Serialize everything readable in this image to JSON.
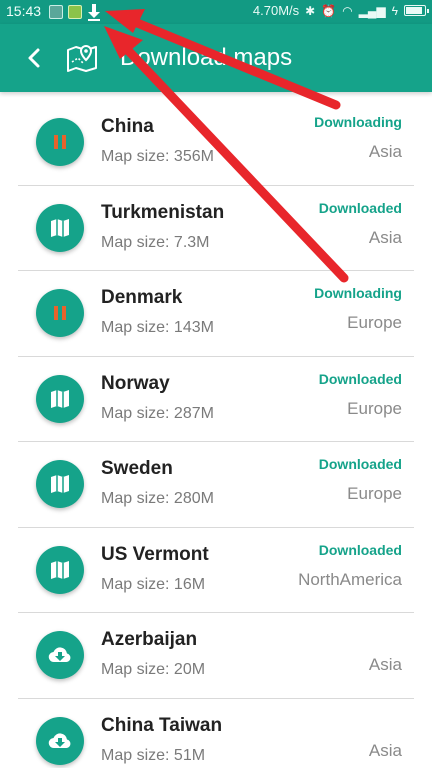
{
  "status_bar": {
    "time": "15:43",
    "speed": "4.70M/s"
  },
  "app_bar": {
    "title": "Download maps",
    "back_icon": "back-icon",
    "map_icon": "map-pin-icon"
  },
  "maps": [
    {
      "name": "China",
      "size": "Map size: 356M",
      "status": "Downloading",
      "region": "Asia",
      "icon": "pause-icon"
    },
    {
      "name": "Turkmenistan",
      "size": "Map size: 7.3M",
      "status": "Downloaded",
      "region": "Asia",
      "icon": "map-icon"
    },
    {
      "name": "Denmark",
      "size": "Map size: 143M",
      "status": "Downloading",
      "region": "Europe",
      "icon": "pause-icon"
    },
    {
      "name": "Norway",
      "size": "Map size: 287M",
      "status": "Downloaded",
      "region": "Europe",
      "icon": "map-icon"
    },
    {
      "name": "Sweden",
      "size": "Map size: 280M",
      "status": "Downloaded",
      "region": "Europe",
      "icon": "map-icon"
    },
    {
      "name": "US Vermont",
      "size": "Map size:  16M",
      "status": "Downloaded",
      "region": "NorthAmerica",
      "icon": "map-icon"
    },
    {
      "name": "Azerbaijan",
      "size": "Map size:  20M",
      "status": "",
      "region": "Asia",
      "icon": "cloud-download-icon"
    },
    {
      "name": "China Taiwan",
      "size": "Map size:  51M",
      "status": "",
      "region": "Asia",
      "icon": "cloud-download-icon"
    }
  ],
  "colors": {
    "accent": "#15a38a",
    "pause": "#e8632b",
    "annotation_arrow": "#e8262b"
  }
}
